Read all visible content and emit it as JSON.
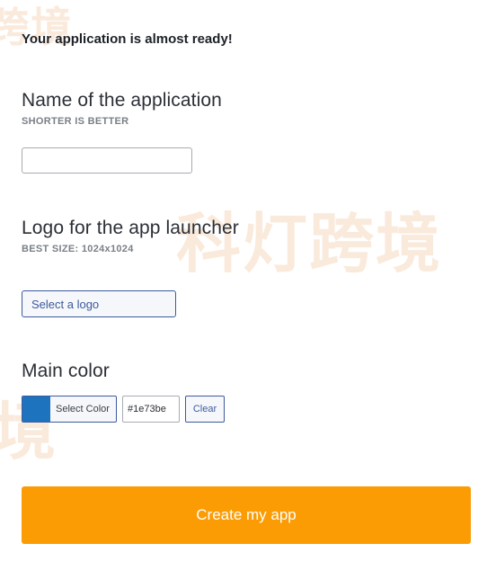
{
  "notice": "Your application is almost ready!",
  "name_section": {
    "heading": "Name of the application",
    "hint": "SHORTER IS BETTER",
    "input_value": "",
    "input_placeholder": ""
  },
  "logo_section": {
    "heading": "Logo for the app launcher",
    "hint": "BEST SIZE: 1024x1024",
    "select_label": "Select a logo"
  },
  "color_section": {
    "heading": "Main color",
    "picker_label": "Select Color",
    "hex_value": "#1e73be",
    "clear_label": "Clear",
    "selected_color": "#1e73be"
  },
  "create_button": {
    "label": "Create my app",
    "color": "#fb9c05"
  },
  "watermark": {
    "text": "科灯跨境",
    "partial_top": "跨境",
    "partial_left": "境"
  }
}
